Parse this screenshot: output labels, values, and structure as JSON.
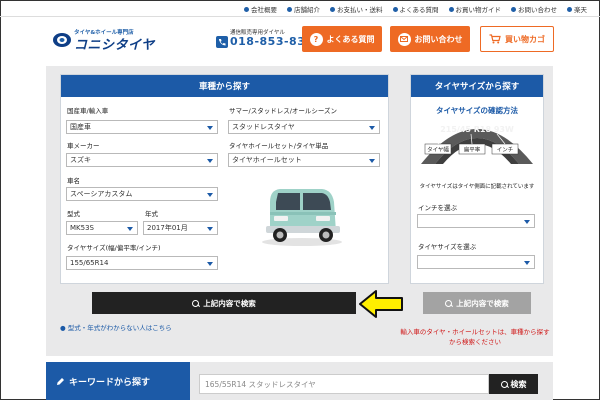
{
  "top_nav": {
    "items": [
      {
        "label": "会社概要"
      },
      {
        "label": "店舗紹介"
      },
      {
        "label": "お支払い・送料"
      },
      {
        "label": "よくある質問"
      },
      {
        "label": "お買い物ガイド"
      },
      {
        "label": "お問い合わせ"
      },
      {
        "label": "楽天"
      }
    ]
  },
  "header": {
    "logo_tagline": "タイヤ&ホイール専門店",
    "logo_name": "コニシタイヤ",
    "phone_label": "通信販売専用ダイヤル",
    "phone_number": "018-853-8303",
    "faq_button": "よくある質問",
    "contact_button": "お問い合わせ",
    "cart_button": "買い物カゴ"
  },
  "car_search": {
    "title": "車種から探す",
    "domestic_label": "国産車/輸入車",
    "domestic_value": "国産車",
    "season_label": "サマー/スタッドレス/オールシーズン",
    "season_value": "スタッドレスタイヤ",
    "maker_label": "車メーカー",
    "maker_value": "スズキ",
    "set_label": "タイヤホイールセット/タイヤ単品",
    "set_value": "タイヤホイールセット",
    "car_name_label": "車名",
    "car_name_value": "スペーシアカスタム",
    "model_label": "型式",
    "model_value": "MK53S",
    "year_label": "年式",
    "year_value": "2017年01月",
    "tire_size_label": "タイヤサイズ(幅/偏平率/インチ)",
    "tire_size_value": "155/65R14",
    "search_button": "上記内容で検索",
    "help_link": "型式・年式がわからない人はこちら"
  },
  "size_search": {
    "title": "タイヤサイズから探す",
    "subtitle": "タイヤサイズの確認方法",
    "tire_marking": "215/45 R18 93W",
    "tag_width": "タイヤ幅",
    "tag_aspect": "扁平率",
    "tag_inch": "インチ",
    "tire_note": "タイヤサイズはタイヤ側面に記載されています",
    "inch_label": "インチを選ぶ",
    "inch_value": "",
    "size_label": "タイヤサイズを選ぶ",
    "size_value": "",
    "search_button": "上記内容で検索",
    "warning": "輸入車のタイヤ・ホイールセットは、車種から探すから検索ください"
  },
  "keyword_search": {
    "title": "キーワードから探す",
    "input_value": "165/55R14 スタッドレスタイヤ",
    "button": "検索"
  },
  "colors": {
    "brand_blue": "#1c5aa7",
    "accent_orange": "#ee6a24",
    "warning_red": "#d01919",
    "callout_yellow": "#ffee00"
  }
}
